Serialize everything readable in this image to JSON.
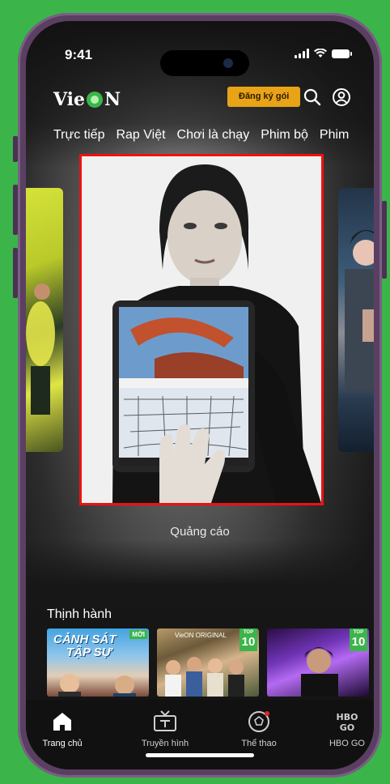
{
  "status_bar": {
    "time": "9:41"
  },
  "header": {
    "logo_left": "Vie",
    "logo_right": "N",
    "subscribe_label": "Đăng ký gói"
  },
  "tabs": [
    "Trực tiếp",
    "Rap Việt",
    "Chơi là chạy",
    "Phim bộ",
    "Phim"
  ],
  "banner": {
    "ad_label": "Quảng cáo"
  },
  "trending": {
    "title": "Thịnh hành",
    "items": [
      {
        "title_line1": "CẢNH SÁT",
        "title_line2": "TẬP SỰ",
        "badge": "MỚI"
      },
      {
        "caption": "VieON ORIGINAL",
        "badge_small": "TOP",
        "badge_number": "10"
      },
      {
        "badge_small": "TOP",
        "badge_number": "10"
      }
    ]
  },
  "bottom_nav": [
    {
      "label": "Trang chủ",
      "icon": "home-icon",
      "active": true
    },
    {
      "label": "Truyền hình",
      "icon": "tv-icon"
    },
    {
      "label": "Thể thao",
      "icon": "soccer-ball-icon"
    },
    {
      "label": "HBO GO",
      "icon": "hbo-go-icon"
    }
  ],
  "colors": {
    "background": "#3bb54a",
    "accent": "#e8a317",
    "brand_green": "#3bb54a",
    "ad_border": "#ee1111"
  }
}
